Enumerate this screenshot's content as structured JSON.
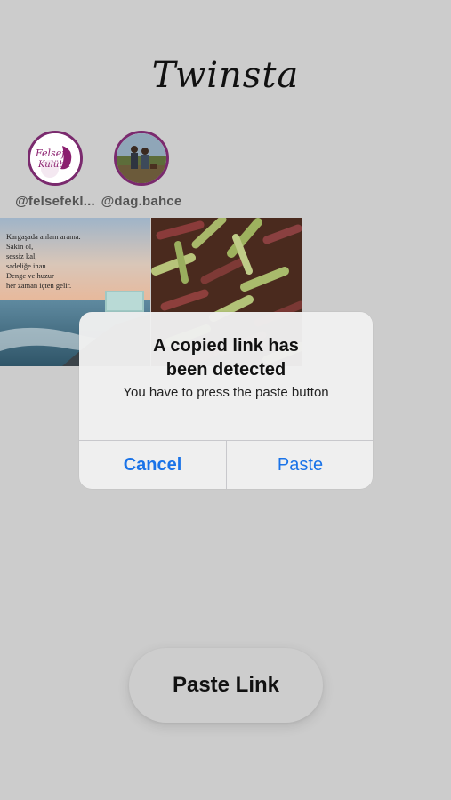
{
  "app": {
    "title": "Twinsta"
  },
  "stories": [
    {
      "username": "@felsefekl...",
      "avatar_text_line1": "Felsefe",
      "avatar_text_line2": "Kulübü"
    },
    {
      "username": "@dag.bahce"
    }
  ],
  "posts": [
    {
      "quote_lines": [
        "Kargaşada anlam arama.",
        "Sakin ol,",
        "sessiz kal,",
        "sadeliğe inan.",
        "Denge ve huzur",
        "her zaman içten gelir."
      ]
    },
    {}
  ],
  "alert": {
    "title_line1": "A copied link has",
    "title_line2": "been detected",
    "message": "You have to press the paste button",
    "cancel_label": "Cancel",
    "paste_label": "Paste"
  },
  "paste_link_button": {
    "label": "Paste Link"
  },
  "colors": {
    "background": "#cccccc",
    "alert_button": "#1a73e8",
    "story_ring": "#7a2a6e"
  }
}
